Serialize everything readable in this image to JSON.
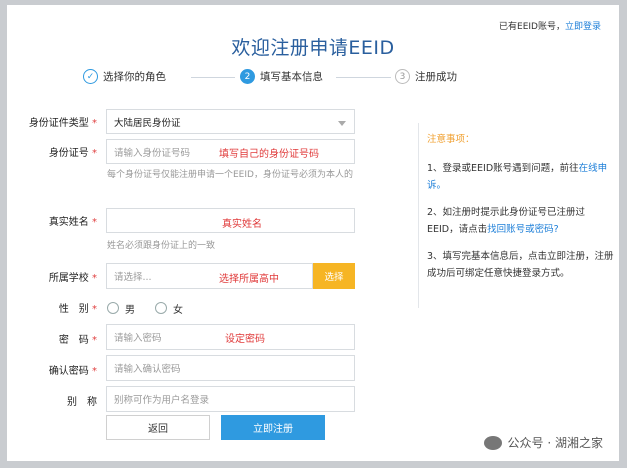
{
  "header": {
    "has_account": "已有EEID账号，",
    "login_link": "立即登录",
    "title": "欢迎注册申请EEID"
  },
  "steps": [
    {
      "num": "✓",
      "label": "选择你的角色",
      "state": "done"
    },
    {
      "num": "2",
      "label": "填写基本信息",
      "state": "active"
    },
    {
      "num": "3",
      "label": "注册成功",
      "state": "todo"
    }
  ],
  "form": {
    "id_type": {
      "label": "身份证件类型",
      "value": "大陆居民身份证"
    },
    "id_number": {
      "label": "身份证号",
      "placeholder": "请输入身份证号码",
      "annotation": "填写自己的身份证号码",
      "hint": "每个身份证号仅能注册申请一个EEID，身份证号必须为本人的"
    },
    "real_name": {
      "label": "真实姓名",
      "annotation": "真实姓名",
      "hint": "姓名必须跟身份证上的一致"
    },
    "school": {
      "label": "所属学校",
      "placeholder": "请选择...",
      "annotation": "选择所属高中",
      "select_button": "选择"
    },
    "gender": {
      "label": "性　别",
      "options": [
        "男",
        "女"
      ]
    },
    "password": {
      "label": "密　码",
      "placeholder": "请输入密码",
      "annotation": "设定密码"
    },
    "confirm_password": {
      "label": "确认密码",
      "placeholder": "请输入确认密码"
    },
    "alias": {
      "label": "别　称",
      "placeholder": "别称可作为用户名登录"
    },
    "back_button": "返回",
    "register_button": "立即注册"
  },
  "notes": {
    "heading": "注意事项：",
    "item1_text": "1、登录或EEID账号遇到问题，前往",
    "item1_link": "在线申诉。",
    "item2_text": "2、如注册时提示此身份证号已注册过EEID，请点击",
    "item2_link": "找回账号或密码?",
    "item3_text": "3、填写完基本信息后，点击立即注册，注册成功后可绑定任意快捷登录方式。"
  },
  "watermark": "公众号 · 湖湘之家",
  "colors": {
    "primary": "#2f9ae0",
    "accent": "#f6b524",
    "annotation": "#e03a3a"
  }
}
